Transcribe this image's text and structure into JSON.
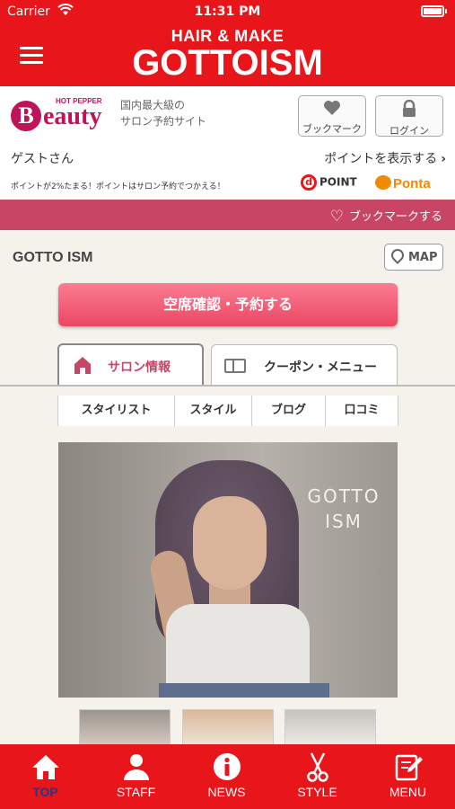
{
  "status_bar": {
    "carrier": "Carrier",
    "time": "11:31 PM"
  },
  "header": {
    "logo_sub": "HAIR & MAKE",
    "logo_main": "GOTTOISM"
  },
  "beauty": {
    "logo_small": "HOT PEPPER",
    "logo_letter": "B",
    "logo_word": "eauty",
    "tagline_line1": "国内最大級の",
    "tagline_line2": "サロン予約サイト",
    "bookmark_label": "ブックマーク",
    "login_label": "ログイン"
  },
  "user": {
    "guest_name": "ゲストさん",
    "points_link": "ポイントを表示する"
  },
  "promo": {
    "text": "ポイントが2%たまる！ポイントはサロン予約でつかえる！",
    "dpoint": "POINT",
    "dpoint_letter": "d",
    "ponta": "Ponta"
  },
  "bookmark_bar": {
    "label": "ブックマークする"
  },
  "salon": {
    "name": "GOTTO ISM",
    "map_label": "MAP",
    "reserve_label": "空席確認・予約する",
    "tabs": [
      {
        "label": "サロン情報",
        "active": true
      },
      {
        "label": "クーポン・メニュー",
        "active": false
      }
    ],
    "subnav": [
      {
        "label": "スタイリスト"
      },
      {
        "label": "スタイル"
      },
      {
        "label": "ブログ"
      },
      {
        "label": "口コミ"
      }
    ],
    "photo_watermark_line1": "GOTTO",
    "photo_watermark_line2": "ISM"
  },
  "tabbar": [
    {
      "label": "TOP",
      "icon": "home-icon",
      "active": true
    },
    {
      "label": "STAFF",
      "icon": "person-icon",
      "active": false
    },
    {
      "label": "NEWS",
      "icon": "info-icon",
      "active": false
    },
    {
      "label": "STYLE",
      "icon": "scissors-icon",
      "active": false
    },
    {
      "label": "MENU",
      "icon": "edit-icon",
      "active": false
    }
  ],
  "colors": {
    "brand_red": "#e8151b",
    "beauty_pink": "#c0145a",
    "bookmark_bar": "#c94566",
    "reserve_button": "#ec4663",
    "active_tab_label": "#1b3a8f"
  }
}
